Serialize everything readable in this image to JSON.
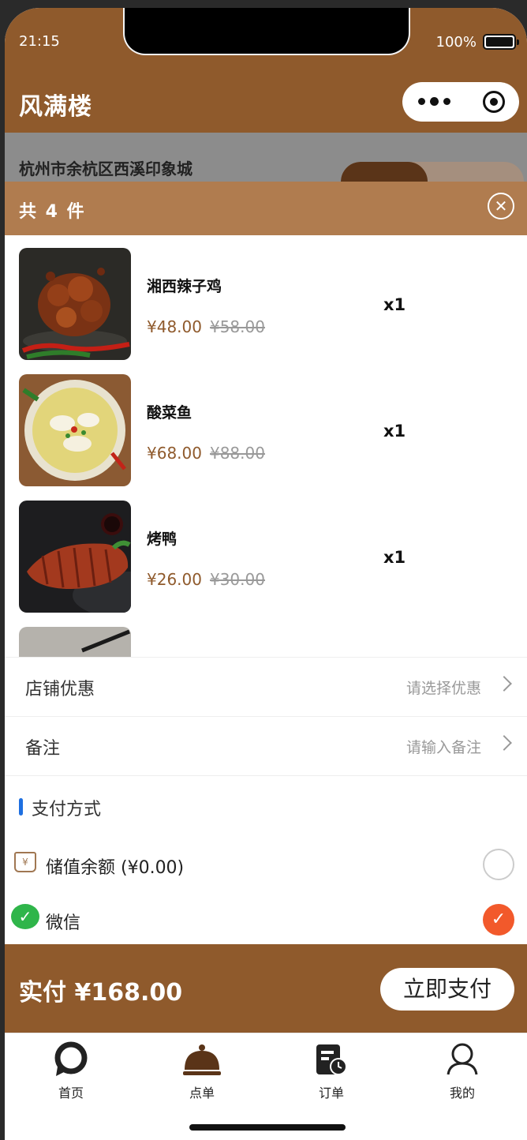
{
  "status_bar": {
    "time": "21:15",
    "battery_percent": "100%"
  },
  "header": {
    "title": "风满楼"
  },
  "capsule": {
    "more_icon": "more-dots-icon",
    "close_icon": "target-icon"
  },
  "store": {
    "address": "杭州市余杭区西溪印象城",
    "mode_dine_in": "",
    "mode_takeout": ""
  },
  "cart": {
    "count_text": "共 4 件",
    "close_label": "✕",
    "items": [
      {
        "name": "湘西辣子鸡",
        "price": "¥48.00",
        "original_price": "¥58.00",
        "qty": "x1"
      },
      {
        "name": "酸菜鱼",
        "price": "¥68.00",
        "original_price": "¥88.00",
        "qty": "x1"
      },
      {
        "name": "烤鸭",
        "price": "¥26.00",
        "original_price": "¥30.00",
        "qty": "x1"
      }
    ]
  },
  "discount": {
    "label": "店铺优惠",
    "value": "请选择优惠"
  },
  "remark": {
    "label": "备注",
    "value": "请输入备注"
  },
  "payment": {
    "title": "支付方式",
    "options": [
      {
        "label": "储值余额 (¥0.00)",
        "icon": "wallet-icon",
        "selected": false
      },
      {
        "label": "微信",
        "icon": "wechat-icon",
        "selected": true
      }
    ]
  },
  "footer": {
    "total": "实付 ¥168.00",
    "pay_button": "立即支付"
  },
  "tabs": [
    {
      "label": "首页",
      "icon": "home-icon"
    },
    {
      "label": "点单",
      "icon": "cloche-icon"
    },
    {
      "label": "订单",
      "icon": "order-clock-icon"
    },
    {
      "label": "我的",
      "icon": "user-icon"
    }
  ],
  "colors": {
    "brand": "#8f5a2c",
    "sheet_header": "#b07c4f",
    "accent_check": "#f2592b",
    "wechat": "#2fb54a"
  }
}
